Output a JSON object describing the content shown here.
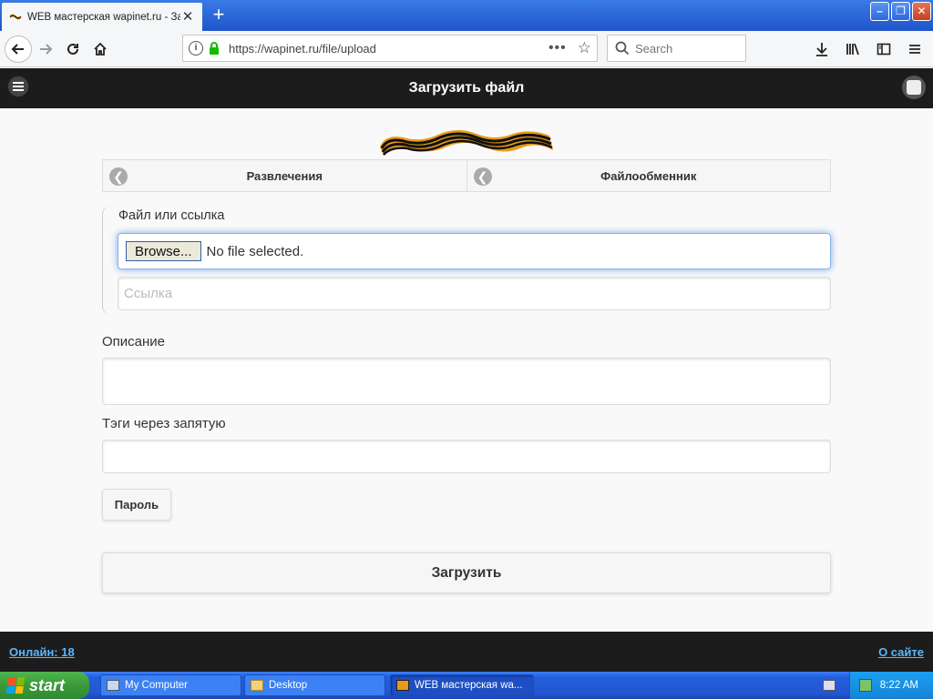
{
  "browser": {
    "tab_title": "WEB мастерская wapinet.ru - Загрузить файл",
    "tab_title_shown": "WEB мастерская wapinet.ru - Заг",
    "new_tab": "+",
    "url": "https://wapinet.ru/file/upload",
    "search_placeholder": "Search",
    "url_dots": "•••",
    "icons": [
      "back-icon",
      "forward-icon",
      "reload-icon",
      "home-icon",
      "info-icon",
      "lock-icon",
      "page-actions-icon",
      "bookmark-star-icon",
      "search-icon",
      "download-icon",
      "library-icon",
      "sidebar-icon",
      "overflow-icon"
    ]
  },
  "site": {
    "title": "Загрузить файл",
    "breadcrumbs": [
      {
        "label": "Развлечения"
      },
      {
        "label": "Файлообменник"
      }
    ],
    "form": {
      "file_legend": "Файл или ссылка",
      "browse_label": "Browse...",
      "no_file": "No file selected.",
      "link_placeholder": "Ссылка",
      "description_label": "Описание",
      "tags_label": "Тэги через запятую",
      "password_button": "Пароль",
      "submit_button": "Загрузить"
    },
    "footer": {
      "online": "Онлайн: 18",
      "about": "О сайте"
    },
    "colors": {
      "header_bg": "#1c1c1c",
      "link": "#5ab7ff",
      "ribbon_orange": "#e89a1a"
    }
  },
  "taskbar": {
    "start": "start",
    "tasks": [
      {
        "label": "My Computer"
      },
      {
        "label": "Desktop"
      },
      {
        "label": "WEB мастерская wa..."
      }
    ],
    "clock": "8:22 AM"
  }
}
